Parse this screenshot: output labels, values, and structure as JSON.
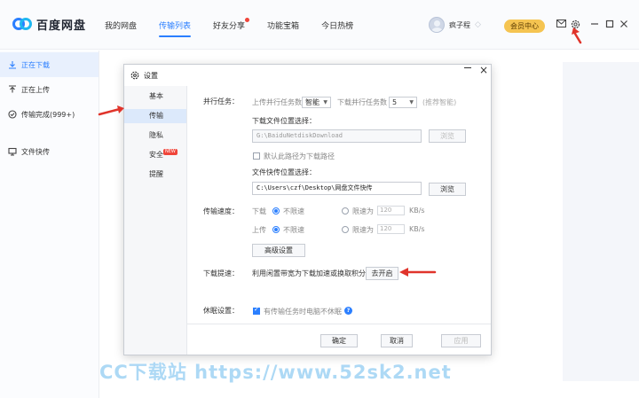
{
  "app": {
    "name": "百度网盘",
    "brand_color": "#2b7fff"
  },
  "nav": {
    "items": [
      {
        "label": "我的网盘"
      },
      {
        "label": "传输列表",
        "active": true
      },
      {
        "label": "好友分享",
        "has_dot": true
      },
      {
        "label": "功能宝箱"
      },
      {
        "label": "今日热榜"
      }
    ]
  },
  "user": {
    "name": "疯子程",
    "vip_label": "会员中心"
  },
  "toolbar_icons": [
    "mail-icon",
    "gear-icon",
    "minimize-icon",
    "maximize-icon",
    "close-icon"
  ],
  "sidebar": {
    "items": [
      {
        "label": "正在下载",
        "icon": "download-icon",
        "active": true
      },
      {
        "label": "正在上传",
        "icon": "upload-icon"
      },
      {
        "label": "传输完成(999+)",
        "icon": "check-circle-icon"
      },
      {
        "label": "文件快传",
        "icon": "monitor-icon"
      }
    ]
  },
  "dialog": {
    "title": "设置",
    "nav": [
      {
        "label": "基本"
      },
      {
        "label": "传输",
        "active": true
      },
      {
        "label": "隐私"
      },
      {
        "label": "安全",
        "badge": "NEW"
      },
      {
        "label": "提醒"
      }
    ],
    "parallel": {
      "section_label": "并行任务：",
      "upload_label": "上传并行任务数",
      "upload_value": "智能",
      "download_label": "下载并行任务数",
      "download_value": "5",
      "hint": "(推荐智能)"
    },
    "download_location": {
      "label": "下载文件位置选择：",
      "path": "G:\\BaiduNetdiskDownload",
      "browse_label": "浏览",
      "default_checkbox_label": "默认此路径为下载路径",
      "default_checked": false
    },
    "quick_transfer_location": {
      "label": "文件快传位置选择：",
      "path": "C:\\Users\\czf\\Desktop\\网盘文件快传",
      "browse_label": "浏览"
    },
    "speed": {
      "section_label": "传输速度：",
      "download_label": "下载",
      "upload_label": "上传",
      "unlimited_label": "不限速",
      "limit_label": "限速为",
      "download_limit_value": "120",
      "upload_limit_value": "120",
      "unit": "KB/s",
      "advanced_label": "高级设置"
    },
    "boost": {
      "section_label": "下载提速：",
      "description": "利用闲置带宽为下载加速或换取积分",
      "button_label": "去开启"
    },
    "sleep": {
      "section_label": "休眠设置：",
      "checkbox_label": "有传输任务时电脑不休眠",
      "checked": true
    },
    "footer": {
      "ok_label": "确定",
      "cancel_label": "取消",
      "apply_label": "应用"
    }
  },
  "annotation_color": "#e0342b",
  "watermark": "CC下载站 https://www.52sk2.net"
}
